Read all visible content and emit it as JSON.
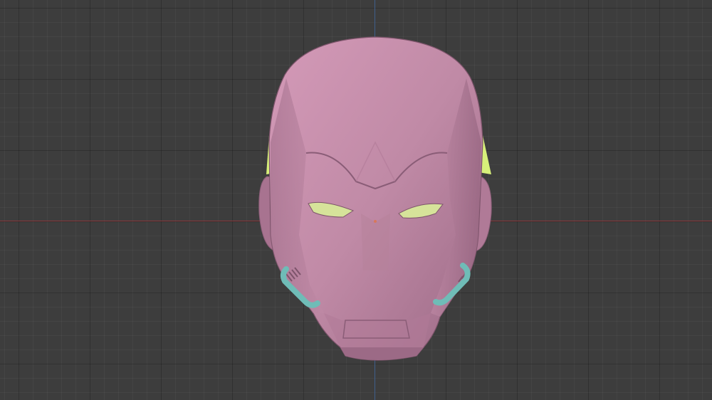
{
  "viewport": {
    "background_color": "#3d3d3d",
    "grid_color": "#2e2e2e",
    "x_axis_color": "#8a3a3d",
    "y_axis_color": "#3f5f8c"
  },
  "model": {
    "name": "helmet-mask",
    "colors": {
      "mask_base": "#c08aa6",
      "mask_shadow": "#9c6a86",
      "mask_highlight": "#d49ab8",
      "eye_lens": "#d6e39a",
      "side_glow": "#d7f07a",
      "tube": "#6fbcb7",
      "tube_shadow": "#4d9a96"
    }
  }
}
